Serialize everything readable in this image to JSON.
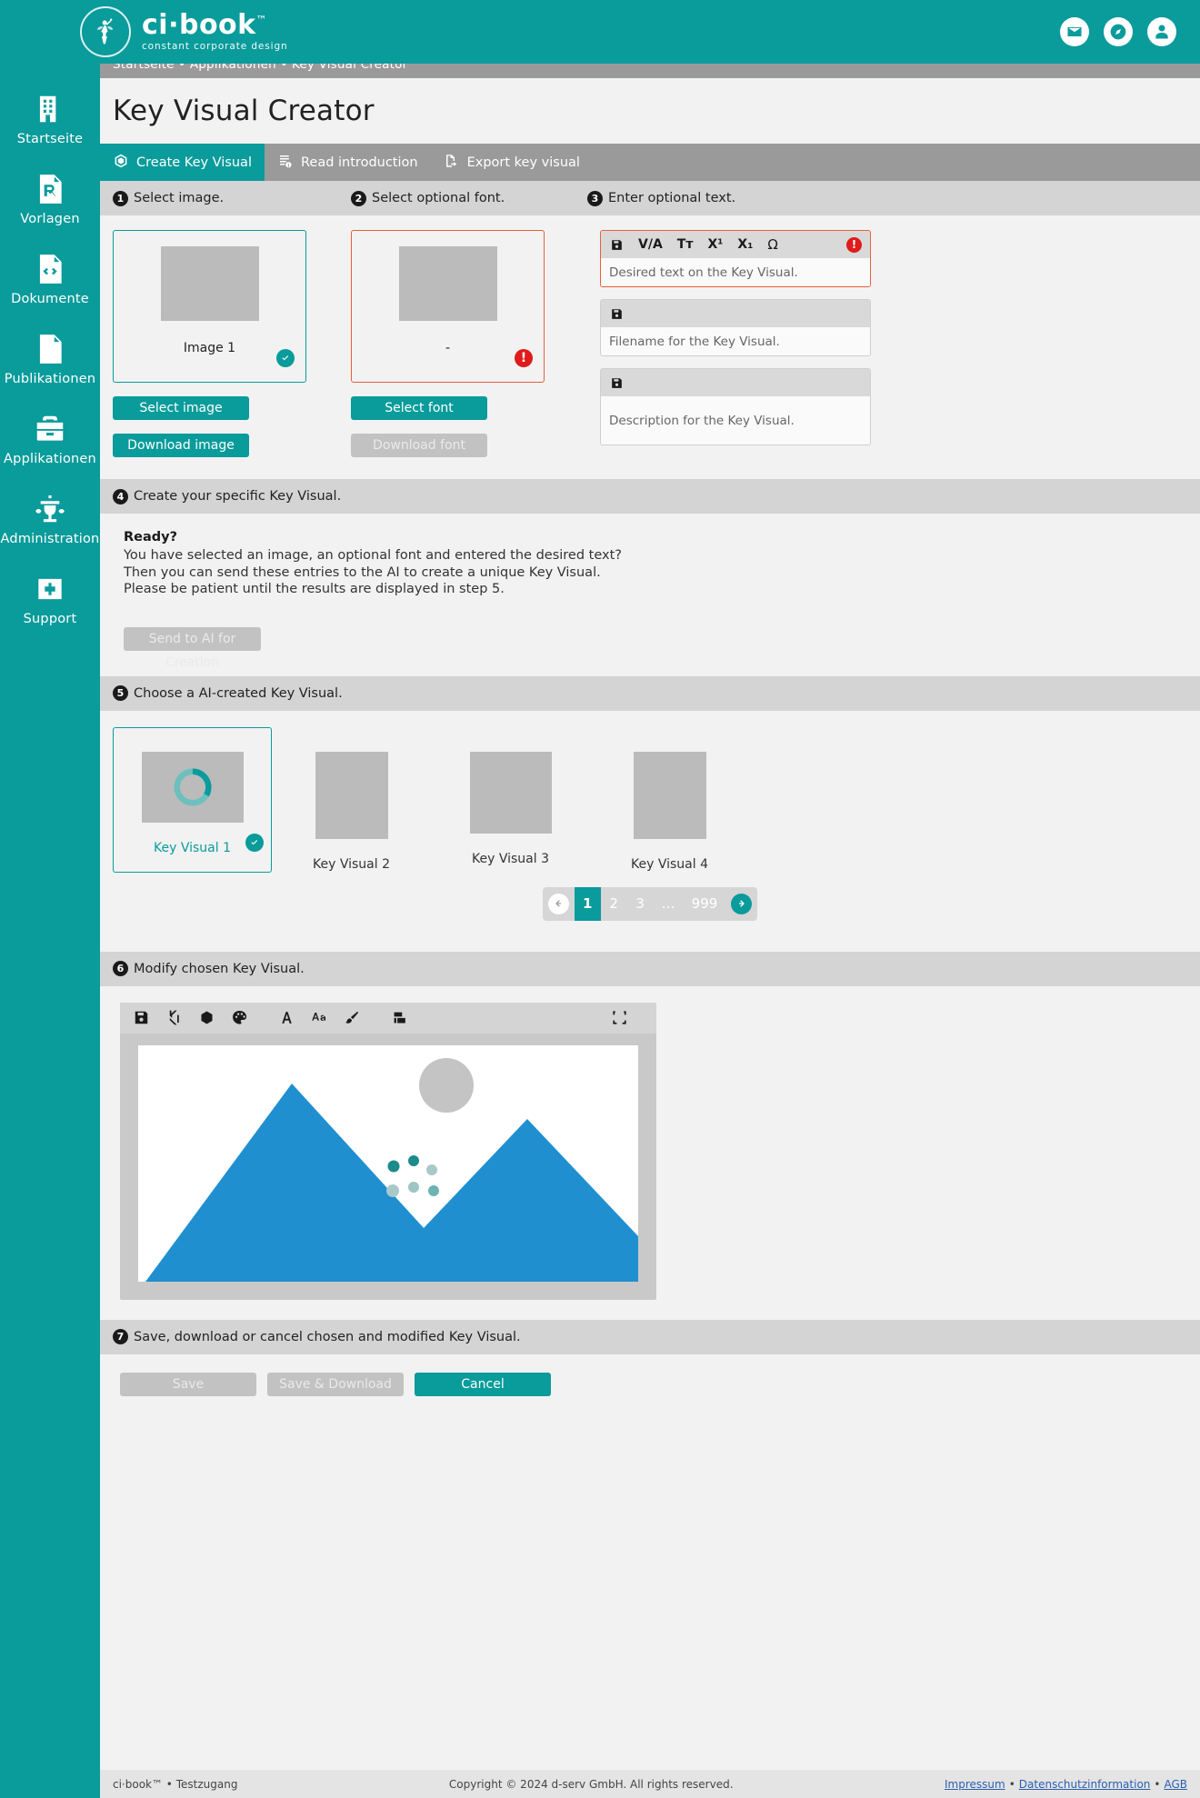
{
  "brand": {
    "name": "ci·book",
    "tm": "™",
    "tagline": "constant corporate design",
    "accent": "#0a9b9b"
  },
  "topbar": {
    "icons": [
      {
        "name": "mail-icon",
        "glyph": "✉"
      },
      {
        "name": "compass-icon",
        "glyph": "⦿"
      },
      {
        "name": "account-icon",
        "glyph": "●"
      }
    ]
  },
  "breadcrumb": "Startseite • Applikationen • Key Visual Creator",
  "page_title": "Key Visual Creator",
  "sidebar": {
    "items": [
      {
        "label": "Startseite",
        "icon": "building-icon"
      },
      {
        "label": "Vorlagen",
        "icon": "prescription-document-icon"
      },
      {
        "label": "Dokumente",
        "icon": "code-document-icon"
      },
      {
        "label": "Publikationen",
        "icon": "bottle-document-icon"
      },
      {
        "label": "Applikationen",
        "icon": "toolbox-icon"
      },
      {
        "label": "Administration",
        "icon": "fountain-icon"
      },
      {
        "label": "Support",
        "icon": "firstaid-icon"
      }
    ]
  },
  "tabs": [
    {
      "label": "Create Key Visual",
      "icon": "polyhedron-icon",
      "active": true
    },
    {
      "label": "Read introduction",
      "icon": "document-info-icon",
      "active": false
    },
    {
      "label": "Export key visual",
      "icon": "document-export-icon",
      "active": false
    }
  ],
  "steps": {
    "s1": {
      "num": "1",
      "title": "Select image."
    },
    "s2": {
      "num": "2",
      "title": "Select optional font."
    },
    "s3": {
      "num": "3",
      "title": "Enter optional text."
    },
    "s4": {
      "num": "4",
      "title": "Create your specific Key Visual."
    },
    "s5": {
      "num": "5",
      "title": "Choose a AI-created Key Visual."
    },
    "s6": {
      "num": "6",
      "title": "Modify chosen Key Visual."
    },
    "s7": {
      "num": "7",
      "title": "Save, download or cancel chosen and modified Key Visual."
    }
  },
  "image_panel": {
    "thumb_label": "Image 1",
    "status": "ok",
    "select_button": "Select image",
    "download_button": "Download image"
  },
  "font_panel": {
    "thumb_label": "-",
    "status": "error",
    "select_button": "Select font",
    "download_button": "Download font",
    "download_disabled": true
  },
  "text_panel": {
    "toolbar_icons": [
      {
        "name": "save-icon",
        "glyph": "💾"
      },
      {
        "name": "kerning-icon",
        "glyph": "V/A"
      },
      {
        "name": "font-size-icon",
        "glyph": "Tᴛ"
      },
      {
        "name": "superscript-icon",
        "glyph": "X¹"
      },
      {
        "name": "subscript-icon",
        "glyph": "X₁"
      },
      {
        "name": "special-character-icon",
        "glyph": "Ω"
      }
    ],
    "error_badge": "!",
    "fields": [
      {
        "id": "keyvisual-text",
        "placeholder": "Desired text on the Key Visual.",
        "value": "",
        "error": true,
        "has_tools": true
      },
      {
        "id": "filename",
        "placeholder": "Filename for the Key Visual.",
        "value": "",
        "error": false,
        "has_tools": false
      },
      {
        "id": "description",
        "placeholder": "Description for the Key Visual.",
        "value": "",
        "error": false,
        "has_tools": false
      }
    ]
  },
  "create_panel": {
    "heading": "Ready?",
    "lines": [
      "You have selected an image, an optional font and entered the desired text?",
      "Then you can send these entries to the AI to create a unique Key Visual.",
      "Please be patient until the results are displayed in step 5."
    ],
    "send_button": "Send to AI for Creation",
    "send_disabled": true
  },
  "choose_panel": {
    "items": [
      {
        "label": "Key Visual 1",
        "selected": true,
        "loading": true,
        "shape": "landscape"
      },
      {
        "label": "Key Visual 2",
        "selected": false,
        "loading": false,
        "shape": "portrait"
      },
      {
        "label": "Key Visual 3",
        "selected": false,
        "loading": false,
        "shape": "square"
      },
      {
        "label": "Key Visual 4",
        "selected": false,
        "loading": false,
        "shape": "portrait"
      }
    ],
    "pagination": {
      "prev_label": "←",
      "next_label": "→",
      "pages": [
        "1",
        "2",
        "3",
        "…",
        "999"
      ],
      "current": "1"
    }
  },
  "editor": {
    "toolbar_icons": [
      {
        "name": "save-icon"
      },
      {
        "name": "crop-icon"
      },
      {
        "name": "shape-icon"
      },
      {
        "name": "palette-icon"
      },
      {
        "name": "text-icon"
      },
      {
        "name": "font-case-icon"
      },
      {
        "name": "brush-icon"
      },
      {
        "name": "layers-icon"
      },
      {
        "name": "fullscreen-icon"
      }
    ],
    "canvas": {
      "sky": "#ffffff",
      "mountain": "#1f8fd0",
      "sun": "#c4c4c4",
      "dots": "#1f8f8f"
    }
  },
  "save_panel": {
    "buttons": [
      {
        "label": "Save",
        "state": "disabled"
      },
      {
        "label": "Save & Download",
        "state": "disabled"
      },
      {
        "label": "Cancel",
        "state": "active"
      }
    ]
  },
  "footer": {
    "left": "ci·book™ • Testzugang",
    "copyright": "Copyright © 2024 d-serv GmbH. All rights reserved.",
    "links": [
      "Impressum",
      "Datenschutzinformation",
      "AGB"
    ],
    "separator": "•"
  }
}
